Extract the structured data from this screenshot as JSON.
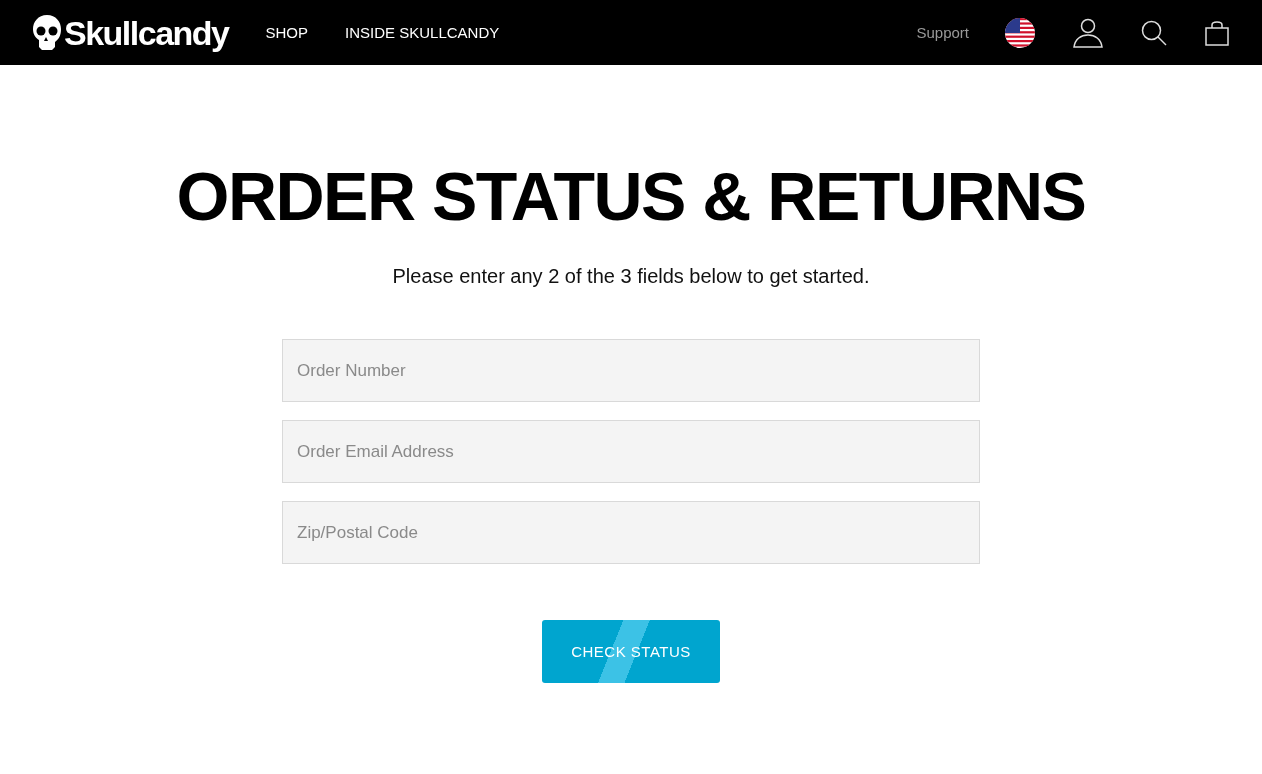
{
  "header": {
    "logo": "Skullcandy",
    "nav": [
      {
        "label": "SHOP"
      },
      {
        "label": "INSIDE SKULLCANDY"
      }
    ],
    "support": "Support"
  },
  "page": {
    "title": "ORDER STATUS & RETURNS",
    "intro": "Please enter any 2 of the 3 fields below to get started.",
    "fields": [
      {
        "placeholder": "Order Number"
      },
      {
        "placeholder": "Order Email Address"
      },
      {
        "placeholder": "Zip/Postal Code"
      }
    ],
    "button": "CHECK STATUS"
  }
}
